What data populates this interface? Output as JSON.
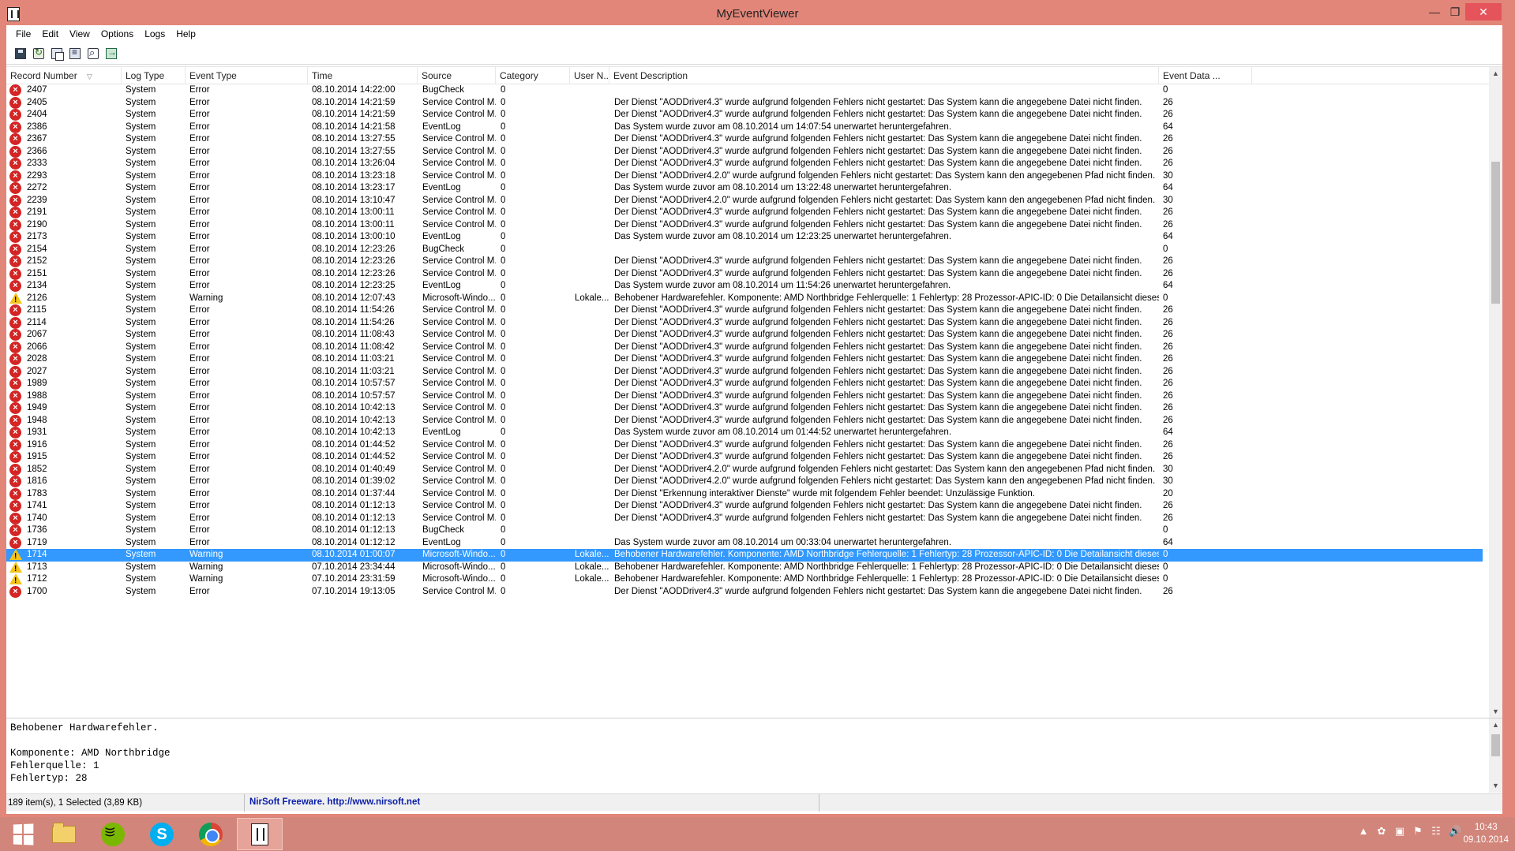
{
  "window": {
    "title": "MyEventViewer"
  },
  "menu": [
    "File",
    "Edit",
    "View",
    "Options",
    "Logs",
    "Help"
  ],
  "toolbar": [
    {
      "name": "save-icon",
      "cls": "save"
    },
    {
      "name": "refresh-icon",
      "cls": "refresh"
    },
    {
      "name": "copy-icon",
      "cls": "copy"
    },
    {
      "name": "properties-icon",
      "cls": "props"
    },
    {
      "name": "find-icon",
      "cls": "find"
    },
    {
      "name": "exit-icon",
      "cls": "exit"
    }
  ],
  "columns": [
    {
      "key": "record",
      "label": "Record Number"
    },
    {
      "key": "log",
      "label": "Log Type"
    },
    {
      "key": "type",
      "label": "Event Type"
    },
    {
      "key": "time",
      "label": "Time"
    },
    {
      "key": "source",
      "label": "Source"
    },
    {
      "key": "category",
      "label": "Category"
    },
    {
      "key": "user",
      "label": "User N..."
    },
    {
      "key": "desc",
      "label": "Event Description"
    },
    {
      "key": "data",
      "label": "Event Data ..."
    }
  ],
  "rows": [
    {
      "record": "2407",
      "log": "System",
      "type": "Error",
      "time": "08.10.2014 14:22:00",
      "source": "BugCheck",
      "category": "0",
      "user": "",
      "desc": "",
      "data": "0"
    },
    {
      "record": "2405",
      "log": "System",
      "type": "Error",
      "time": "08.10.2014 14:21:59",
      "source": "Service Control M...",
      "category": "0",
      "user": "",
      "desc": "Der Dienst \"AODDriver4.3\" wurde aufgrund folgenden Fehlers nicht gestartet:   Das System kann die angegebene Datei nicht finden.",
      "data": "26"
    },
    {
      "record": "2404",
      "log": "System",
      "type": "Error",
      "time": "08.10.2014 14:21:59",
      "source": "Service Control M...",
      "category": "0",
      "user": "",
      "desc": "Der Dienst \"AODDriver4.3\" wurde aufgrund folgenden Fehlers nicht gestartet:   Das System kann die angegebene Datei nicht finden.",
      "data": "26"
    },
    {
      "record": "2386",
      "log": "System",
      "type": "Error",
      "time": "08.10.2014 14:21:58",
      "source": "EventLog",
      "category": "0",
      "user": "",
      "desc": "Das System wurde zuvor am 08.10.2014 um 14:07:54 unerwartet heruntergefahren.",
      "data": "64"
    },
    {
      "record": "2367",
      "log": "System",
      "type": "Error",
      "time": "08.10.2014 13:27:55",
      "source": "Service Control M...",
      "category": "0",
      "user": "",
      "desc": "Der Dienst \"AODDriver4.3\" wurde aufgrund folgenden Fehlers nicht gestartet:   Das System kann die angegebene Datei nicht finden.",
      "data": "26"
    },
    {
      "record": "2366",
      "log": "System",
      "type": "Error",
      "time": "08.10.2014 13:27:55",
      "source": "Service Control M...",
      "category": "0",
      "user": "",
      "desc": "Der Dienst \"AODDriver4.3\" wurde aufgrund folgenden Fehlers nicht gestartet:   Das System kann die angegebene Datei nicht finden.",
      "data": "26"
    },
    {
      "record": "2333",
      "log": "System",
      "type": "Error",
      "time": "08.10.2014 13:26:04",
      "source": "Service Control M...",
      "category": "0",
      "user": "",
      "desc": "Der Dienst \"AODDriver4.3\" wurde aufgrund folgenden Fehlers nicht gestartet:   Das System kann die angegebene Datei nicht finden.",
      "data": "26"
    },
    {
      "record": "2293",
      "log": "System",
      "type": "Error",
      "time": "08.10.2014 13:23:18",
      "source": "Service Control M...",
      "category": "0",
      "user": "",
      "desc": "Der Dienst \"AODDriver4.2.0\" wurde aufgrund folgenden Fehlers nicht gestartet:   Das System kann den angegebenen Pfad nicht finden.",
      "data": "30"
    },
    {
      "record": "2272",
      "log": "System",
      "type": "Error",
      "time": "08.10.2014 13:23:17",
      "source": "EventLog",
      "category": "0",
      "user": "",
      "desc": "Das System wurde zuvor am 08.10.2014 um 13:22:48 unerwartet heruntergefahren.",
      "data": "64"
    },
    {
      "record": "2239",
      "log": "System",
      "type": "Error",
      "time": "08.10.2014 13:10:47",
      "source": "Service Control M...",
      "category": "0",
      "user": "",
      "desc": "Der Dienst \"AODDriver4.2.0\" wurde aufgrund folgenden Fehlers nicht gestartet:   Das System kann den angegebenen Pfad nicht finden.",
      "data": "30"
    },
    {
      "record": "2191",
      "log": "System",
      "type": "Error",
      "time": "08.10.2014 13:00:11",
      "source": "Service Control M...",
      "category": "0",
      "user": "",
      "desc": "Der Dienst \"AODDriver4.3\" wurde aufgrund folgenden Fehlers nicht gestartet:   Das System kann die angegebene Datei nicht finden.",
      "data": "26"
    },
    {
      "record": "2190",
      "log": "System",
      "type": "Error",
      "time": "08.10.2014 13:00:11",
      "source": "Service Control M...",
      "category": "0",
      "user": "",
      "desc": "Der Dienst \"AODDriver4.3\" wurde aufgrund folgenden Fehlers nicht gestartet:   Das System kann die angegebene Datei nicht finden.",
      "data": "26"
    },
    {
      "record": "2173",
      "log": "System",
      "type": "Error",
      "time": "08.10.2014 13:00:10",
      "source": "EventLog",
      "category": "0",
      "user": "",
      "desc": "Das System wurde zuvor am 08.10.2014 um 12:23:25 unerwartet heruntergefahren.",
      "data": "64"
    },
    {
      "record": "2154",
      "log": "System",
      "type": "Error",
      "time": "08.10.2014 12:23:26",
      "source": "BugCheck",
      "category": "0",
      "user": "",
      "desc": "",
      "data": "0"
    },
    {
      "record": "2152",
      "log": "System",
      "type": "Error",
      "time": "08.10.2014 12:23:26",
      "source": "Service Control M...",
      "category": "0",
      "user": "",
      "desc": "Der Dienst \"AODDriver4.3\" wurde aufgrund folgenden Fehlers nicht gestartet:   Das System kann die angegebene Datei nicht finden.",
      "data": "26"
    },
    {
      "record": "2151",
      "log": "System",
      "type": "Error",
      "time": "08.10.2014 12:23:26",
      "source": "Service Control M...",
      "category": "0",
      "user": "",
      "desc": "Der Dienst \"AODDriver4.3\" wurde aufgrund folgenden Fehlers nicht gestartet:   Das System kann die angegebene Datei nicht finden.",
      "data": "26"
    },
    {
      "record": "2134",
      "log": "System",
      "type": "Error",
      "time": "08.10.2014 12:23:25",
      "source": "EventLog",
      "category": "0",
      "user": "",
      "desc": "Das System wurde zuvor am 08.10.2014 um 11:54:26 unerwartet heruntergefahren.",
      "data": "64"
    },
    {
      "record": "2126",
      "log": "System",
      "type": "Warning",
      "time": "08.10.2014 12:07:43",
      "source": "Microsoft-Windo...",
      "category": "0",
      "user": "Lokale...",
      "desc": "Behobener Hardwarefehler.   Komponente: AMD Northbridge  Fehlerquelle: 1  Fehlertyp: 28  Prozessor-APIC-ID: 0   Die Detailansicht dieses Eintrags beinhalte...",
      "data": "0"
    },
    {
      "record": "2115",
      "log": "System",
      "type": "Error",
      "time": "08.10.2014 11:54:26",
      "source": "Service Control M...",
      "category": "0",
      "user": "",
      "desc": "Der Dienst \"AODDriver4.3\" wurde aufgrund folgenden Fehlers nicht gestartet:   Das System kann die angegebene Datei nicht finden.",
      "data": "26"
    },
    {
      "record": "2114",
      "log": "System",
      "type": "Error",
      "time": "08.10.2014 11:54:26",
      "source": "Service Control M...",
      "category": "0",
      "user": "",
      "desc": "Der Dienst \"AODDriver4.3\" wurde aufgrund folgenden Fehlers nicht gestartet:   Das System kann die angegebene Datei nicht finden.",
      "data": "26"
    },
    {
      "record": "2067",
      "log": "System",
      "type": "Error",
      "time": "08.10.2014 11:08:43",
      "source": "Service Control M...",
      "category": "0",
      "user": "",
      "desc": "Der Dienst \"AODDriver4.3\" wurde aufgrund folgenden Fehlers nicht gestartet:   Das System kann die angegebene Datei nicht finden.",
      "data": "26"
    },
    {
      "record": "2066",
      "log": "System",
      "type": "Error",
      "time": "08.10.2014 11:08:42",
      "source": "Service Control M...",
      "category": "0",
      "user": "",
      "desc": "Der Dienst \"AODDriver4.3\" wurde aufgrund folgenden Fehlers nicht gestartet:   Das System kann die angegebene Datei nicht finden.",
      "data": "26"
    },
    {
      "record": "2028",
      "log": "System",
      "type": "Error",
      "time": "08.10.2014 11:03:21",
      "source": "Service Control M...",
      "category": "0",
      "user": "",
      "desc": "Der Dienst \"AODDriver4.3\" wurde aufgrund folgenden Fehlers nicht gestartet:   Das System kann die angegebene Datei nicht finden.",
      "data": "26"
    },
    {
      "record": "2027",
      "log": "System",
      "type": "Error",
      "time": "08.10.2014 11:03:21",
      "source": "Service Control M...",
      "category": "0",
      "user": "",
      "desc": "Der Dienst \"AODDriver4.3\" wurde aufgrund folgenden Fehlers nicht gestartet:   Das System kann die angegebene Datei nicht finden.",
      "data": "26"
    },
    {
      "record": "1989",
      "log": "System",
      "type": "Error",
      "time": "08.10.2014 10:57:57",
      "source": "Service Control M...",
      "category": "0",
      "user": "",
      "desc": "Der Dienst \"AODDriver4.3\" wurde aufgrund folgenden Fehlers nicht gestartet:   Das System kann die angegebene Datei nicht finden.",
      "data": "26"
    },
    {
      "record": "1988",
      "log": "System",
      "type": "Error",
      "time": "08.10.2014 10:57:57",
      "source": "Service Control M...",
      "category": "0",
      "user": "",
      "desc": "Der Dienst \"AODDriver4.3\" wurde aufgrund folgenden Fehlers nicht gestartet:   Das System kann die angegebene Datei nicht finden.",
      "data": "26"
    },
    {
      "record": "1949",
      "log": "System",
      "type": "Error",
      "time": "08.10.2014 10:42:13",
      "source": "Service Control M...",
      "category": "0",
      "user": "",
      "desc": "Der Dienst \"AODDriver4.3\" wurde aufgrund folgenden Fehlers nicht gestartet:   Das System kann die angegebene Datei nicht finden.",
      "data": "26"
    },
    {
      "record": "1948",
      "log": "System",
      "type": "Error",
      "time": "08.10.2014 10:42:13",
      "source": "Service Control M...",
      "category": "0",
      "user": "",
      "desc": "Der Dienst \"AODDriver4.3\" wurde aufgrund folgenden Fehlers nicht gestartet:   Das System kann die angegebene Datei nicht finden.",
      "data": "26"
    },
    {
      "record": "1931",
      "log": "System",
      "type": "Error",
      "time": "08.10.2014 10:42:13",
      "source": "EventLog",
      "category": "0",
      "user": "",
      "desc": "Das System wurde zuvor am 08.10.2014 um 01:44:52 unerwartet heruntergefahren.",
      "data": "64"
    },
    {
      "record": "1916",
      "log": "System",
      "type": "Error",
      "time": "08.10.2014 01:44:52",
      "source": "Service Control M...",
      "category": "0",
      "user": "",
      "desc": "Der Dienst \"AODDriver4.3\" wurde aufgrund folgenden Fehlers nicht gestartet:   Das System kann die angegebene Datei nicht finden.",
      "data": "26"
    },
    {
      "record": "1915",
      "log": "System",
      "type": "Error",
      "time": "08.10.2014 01:44:52",
      "source": "Service Control M...",
      "category": "0",
      "user": "",
      "desc": "Der Dienst \"AODDriver4.3\" wurde aufgrund folgenden Fehlers nicht gestartet:   Das System kann die angegebene Datei nicht finden.",
      "data": "26"
    },
    {
      "record": "1852",
      "log": "System",
      "type": "Error",
      "time": "08.10.2014 01:40:49",
      "source": "Service Control M...",
      "category": "0",
      "user": "",
      "desc": "Der Dienst \"AODDriver4.2.0\" wurde aufgrund folgenden Fehlers nicht gestartet:   Das System kann den angegebenen Pfad nicht finden.",
      "data": "30"
    },
    {
      "record": "1816",
      "log": "System",
      "type": "Error",
      "time": "08.10.2014 01:39:02",
      "source": "Service Control M...",
      "category": "0",
      "user": "",
      "desc": "Der Dienst \"AODDriver4.2.0\" wurde aufgrund folgenden Fehlers nicht gestartet:   Das System kann den angegebenen Pfad nicht finden.",
      "data": "30"
    },
    {
      "record": "1783",
      "log": "System",
      "type": "Error",
      "time": "08.10.2014 01:37:44",
      "source": "Service Control M...",
      "category": "0",
      "user": "",
      "desc": "Der Dienst \"Erkennung interaktiver Dienste\" wurde mit folgendem Fehler beendet:   Unzulässige Funktion.",
      "data": "20"
    },
    {
      "record": "1741",
      "log": "System",
      "type": "Error",
      "time": "08.10.2014 01:12:13",
      "source": "Service Control M...",
      "category": "0",
      "user": "",
      "desc": "Der Dienst \"AODDriver4.3\" wurde aufgrund folgenden Fehlers nicht gestartet:   Das System kann die angegebene Datei nicht finden.",
      "data": "26"
    },
    {
      "record": "1740",
      "log": "System",
      "type": "Error",
      "time": "08.10.2014 01:12:13",
      "source": "Service Control M...",
      "category": "0",
      "user": "",
      "desc": "Der Dienst \"AODDriver4.3\" wurde aufgrund folgenden Fehlers nicht gestartet:   Das System kann die angegebene Datei nicht finden.",
      "data": "26"
    },
    {
      "record": "1736",
      "log": "System",
      "type": "Error",
      "time": "08.10.2014 01:12:13",
      "source": "BugCheck",
      "category": "0",
      "user": "",
      "desc": "",
      "data": "0"
    },
    {
      "record": "1719",
      "log": "System",
      "type": "Error",
      "time": "08.10.2014 01:12:12",
      "source": "EventLog",
      "category": "0",
      "user": "",
      "desc": "Das System wurde zuvor am 08.10.2014 um 00:33:04 unerwartet heruntergefahren.",
      "data": "64"
    },
    {
      "record": "1714",
      "log": "System",
      "type": "Warning",
      "time": "08.10.2014 01:00:07",
      "source": "Microsoft-Windo...",
      "category": "0",
      "user": "Lokale...",
      "desc": "Behobener Hardwarefehler.   Komponente: AMD Northbridge  Fehlerquelle: 1  Fehlertyp: 28  Prozessor-APIC-ID: 0   Die Detailansicht dieses Eintrags beinhalte...",
      "data": "0",
      "selected": true
    },
    {
      "record": "1713",
      "log": "System",
      "type": "Warning",
      "time": "07.10.2014 23:34:44",
      "source": "Microsoft-Windo...",
      "category": "0",
      "user": "Lokale...",
      "desc": "Behobener Hardwarefehler.   Komponente: AMD Northbridge  Fehlerquelle: 1  Fehlertyp: 28  Prozessor-APIC-ID: 0   Die Detailansicht dieses Eintrags beinhalte...",
      "data": "0"
    },
    {
      "record": "1712",
      "log": "System",
      "type": "Warning",
      "time": "07.10.2014 23:31:59",
      "source": "Microsoft-Windo...",
      "category": "0",
      "user": "Lokale...",
      "desc": "Behobener Hardwarefehler.   Komponente: AMD Northbridge  Fehlerquelle: 1  Fehlertyp: 28  Prozessor-APIC-ID: 0   Die Detailansicht dieses Eintrags beinhalte...",
      "data": "0"
    },
    {
      "record": "1700",
      "log": "System",
      "type": "Error",
      "time": "07.10.2014 19:13:05",
      "source": "Service Control M...",
      "category": "0",
      "user": "",
      "desc": "Der Dienst \"AODDriver4.3\" wurde aufgrund folgenden Fehlers nicht gestartet:   Das System kann die angegebene Datei nicht finden.",
      "data": "26"
    }
  ],
  "detail": {
    "text": "Behobener Hardwarefehler.\n\nKomponente: AMD Northbridge\nFehlerquelle: 1\nFehlertyp: 28"
  },
  "status": {
    "items": "189 item(s), 1 Selected  (3,89 KB)",
    "link": "NirSoft Freeware.  http://www.nirsoft.net"
  },
  "taskbar": {
    "apps": [
      {
        "name": "start-button",
        "icon": "windows-start-icon"
      },
      {
        "name": "taskbar-explorer",
        "icon": "folder-icon"
      },
      {
        "name": "taskbar-spotify",
        "icon": "spotify-icon"
      },
      {
        "name": "taskbar-skype",
        "icon": "skype-icon"
      },
      {
        "name": "taskbar-chrome",
        "icon": "chrome-icon"
      },
      {
        "name": "taskbar-myeventviewer",
        "icon": "myeventviewer-icon"
      }
    ],
    "time": "10:43",
    "date": "09.10.2014"
  }
}
